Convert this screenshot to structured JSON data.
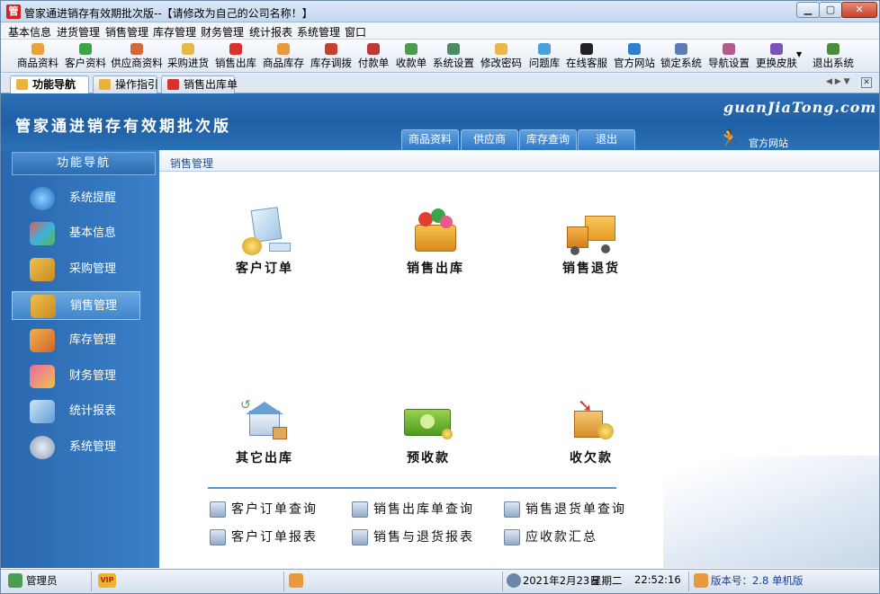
{
  "window": {
    "title": "管家通进销存有效期批次版--【请修改为自己的公司名称！】",
    "icon_glyph": "管"
  },
  "menubar": [
    "基本信息",
    "进货管理",
    "销售管理",
    "库存管理",
    "财务管理",
    "统计报表",
    "系统管理",
    "窗口"
  ],
  "toolbar": [
    "商品资料",
    "客户资料",
    "供应商资料",
    "采购进货",
    "销售出库",
    "商品库存",
    "库存调拨",
    "付款单",
    "收款单",
    "系统设置",
    "修改密码",
    "问题库",
    "在线客服",
    "官方网站",
    "锁定系统",
    "导航设置",
    "更换皮肤",
    "退出系统"
  ],
  "tabs": [
    "功能导航",
    "操作指引",
    "销售出库单"
  ],
  "banner": {
    "title": "管家通进销存有效期批次版",
    "brand": "guanJiaTong.com",
    "tabs": [
      "商品资料",
      "供应商",
      "库存查询",
      "退出"
    ],
    "official_link": "官方网站"
  },
  "sidebar": {
    "header": "功能导航",
    "items": [
      "系统提醒",
      "基本信息",
      "采购管理",
      "销售管理",
      "库存管理",
      "财务管理",
      "统计报表",
      "系统管理"
    ],
    "active": "销售管理"
  },
  "main": {
    "crumb": "销售管理",
    "items": [
      "客户订单",
      "销售出库",
      "销售退货",
      "其它出库",
      "预收款",
      "收欠款"
    ],
    "links": [
      "客户订单查询",
      "销售出库单查询",
      "销售退货单查询",
      "客户订单报表",
      "销售与退货报表",
      "应收款汇总"
    ]
  },
  "status": {
    "user": "管理员",
    "vip": "VIP",
    "date": "2021年2月23日",
    "weekday": "星期二",
    "time": "22:52:16",
    "version": "版本号：2.8 单机版"
  },
  "colors": {
    "banner": "#2366ac",
    "sidebar": "#3276bd",
    "accent": "#ffcc00"
  }
}
